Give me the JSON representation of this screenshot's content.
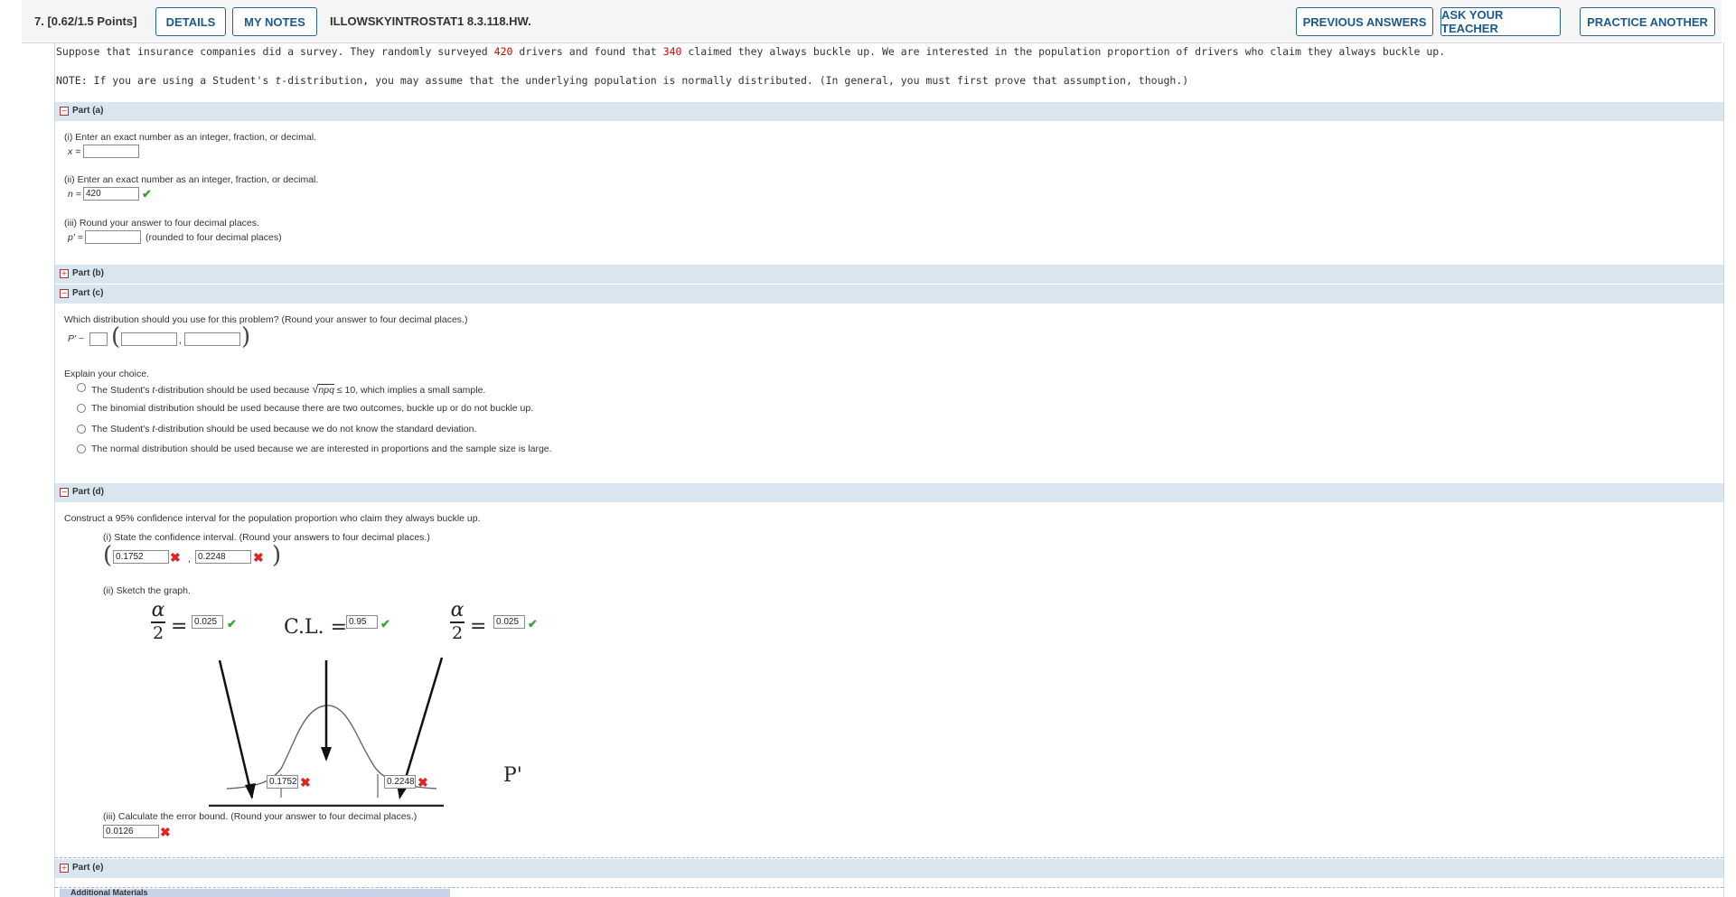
{
  "header": {
    "question_label": "7. [0.62/1.5 Points]",
    "details_label": "DETAILS",
    "my_notes_label": "MY NOTES",
    "assignment_id": "ILLOWSKYINTROSTAT1 8.3.118.HW.",
    "previous_answers_label": "PREVIOUS ANSWERS",
    "ask_teacher_label": "ASK YOUR TEACHER",
    "practice_another_label": "PRACTICE ANOTHER"
  },
  "problem": {
    "text_1": "Suppose that insurance companies did a survey. They randomly surveyed",
    "drivers_count": "420",
    "text_2": "drivers and found that",
    "buckle_count": "340",
    "text_3": "claimed they always buckle up. We are interested in the population proportion of drivers who claim they always buckle up.",
    "note_1": "NOTE: If you are using a Student's",
    "note_t": "t",
    "note_2": "-distribution, you may assume that the underlying population is normally distributed. (In general, you must first prove that assumption, though.)"
  },
  "part_a": {
    "title": "Part (a)",
    "toggle": "−",
    "q1": "(i) Enter an exact number as an integer, fraction, or decimal.",
    "x_label": "x =",
    "x_value": "",
    "q2": "(ii) Enter an exact number as an integer, fraction, or decimal.",
    "n_label": "n =",
    "n_value": "420",
    "q3": "(iii) Round your answer to four decimal places.",
    "p_label": "p' =",
    "p_value": "",
    "p_note": "(rounded to four decimal places)"
  },
  "part_b": {
    "title": "Part (b)",
    "toggle": "+"
  },
  "part_c": {
    "title": "Part (c)",
    "toggle": "−",
    "question": "Which distribution should you use for this problem? (Round your answer to four decimal places.)",
    "dist_label": "P' ~",
    "dist_value": "",
    "param1": "",
    "param2": "",
    "explain": "Explain your choice.",
    "options": [
      {
        "pre": "The Student's ",
        "t": "t",
        "post": "-distribution should be used because ",
        "sqrt": "npq",
        "tail": " ≤ 10, which implies a small sample."
      },
      {
        "pre": "The binomial distribution should be used because there are two outcomes, buckle up or do not buckle up.",
        "t": "",
        "post": "",
        "sqrt": "",
        "tail": ""
      },
      {
        "pre": "The Student's ",
        "t": "t",
        "post": "-distribution should be used because we do not know the standard deviation.",
        "sqrt": "",
        "tail": ""
      },
      {
        "pre": "The normal distribution should be used because we are interested in proportions and the sample size is large.",
        "t": "",
        "post": "",
        "sqrt": "",
        "tail": ""
      }
    ]
  },
  "part_d": {
    "title": "Part (d)",
    "toggle": "−",
    "intro": "Construct a 95% confidence interval for the population proportion who claim they always buckle up.",
    "q1": "(i) State the confidence interval. (Round your answers to four decimal places.)",
    "ci_low": "0.1752",
    "ci_high": "0.2248",
    "q2": "(ii) Sketch the graph.",
    "alpha_num": "α",
    "alpha_den": "2",
    "equals": "=",
    "alpha_left_value": "0.025",
    "cl_label": "C.L. =",
    "cl_value": "0.95",
    "alpha_right_value": "0.025",
    "graph_low": "0.1752",
    "graph_high": "0.2248",
    "axis_label": "P'",
    "q3": "(iii) Calculate the error bound. (Round your answer to four decimal places.)",
    "ebp_value": "0.0126"
  },
  "part_e": {
    "title": "Part (e)",
    "toggle": "+"
  },
  "footer": {
    "additional_materials": "Additional Materials"
  },
  "marks": {
    "check": "✔",
    "cross": "✖"
  }
}
